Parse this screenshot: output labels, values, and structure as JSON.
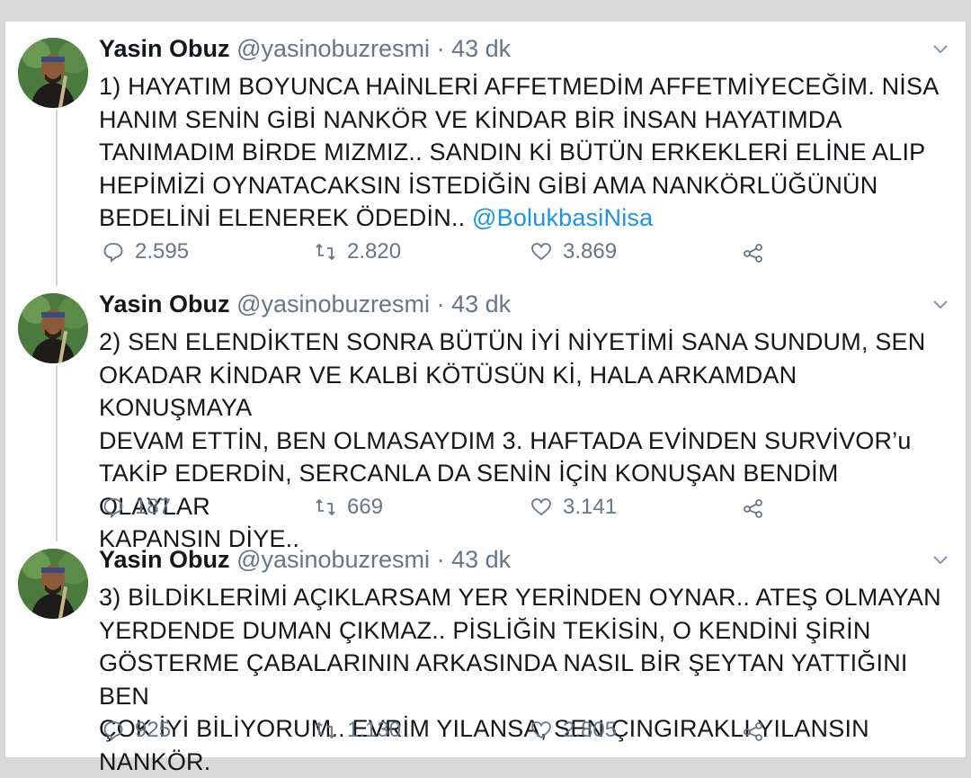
{
  "tweets": [
    {
      "name": "Yasin Obuz",
      "handle": "@yasinobuzresmi",
      "separator": "·",
      "time": "43 dk",
      "text_lines": [
        "1) HAYATIM BOYUNCA HAİNLERİ AFFETMEDİM AFFETMİYECEĞİM. NİSA",
        "HANIM SENİN GİBİ NANKÖR VE KİNDAR BİR İNSAN HAYATIMDA",
        "TANIMADIM BİRDE MIZMIZ.. SANDIN Kİ BÜTÜN ERKEKLERİ ELİNE ALIP",
        "HEPİMİZİ OYNATACAKSIN İSTEDİĞİN GİBİ AMA NANKÖRLÜĞÜNÜN",
        "BEDELİNİ ELENEREK ÖDEDİN.. "
      ],
      "mention": "@BolukbasiNisa",
      "replies": "2.595",
      "retweets": "2.820",
      "likes": "3.869"
    },
    {
      "name": "Yasin Obuz",
      "handle": "@yasinobuzresmi",
      "separator": "·",
      "time": "43 dk",
      "text_lines": [
        "2) SEN ELENDİKTEN SONRA BÜTÜN İYİ NİYETİMİ SANA SUNDUM, SEN",
        "OKADAR KİNDAR VE KALBİ KÖTÜSÜN Kİ, HALA ARKAMDAN KONUŞMAYA",
        "DEVAM ETTİN, BEN OLMASAYDIM 3. HAFTADA EVİNDEN SURVİVOR’u",
        "TAKİP EDERDİN, SERCANLA DA SENİN İÇİN KONUŞAN BENDİM OLAYLAR",
        "KAPANSIN DİYE.."
      ],
      "mention": "",
      "replies": "187",
      "retweets": "669",
      "likes": "3.141"
    },
    {
      "name": "Yasin Obuz",
      "handle": "@yasinobuzresmi",
      "separator": "·",
      "time": "43 dk",
      "text_lines": [
        "3) BİLDİKLERİMİ AÇIKLARSAM YER YERİNDEN OYNAR.. ATEŞ OLMAYAN",
        "YERDENDE DUMAN ÇIKMAZ.. PİSLİĞİN TEKİSİN, O KENDİNİ ŞİRİN",
        "GÖSTERME ÇABALARININ ARKASINDA NASIL BİR ŞEYTAN YATTIĞINI BEN",
        "ÇOK İYİ BİLİYORUM.. EVRİM YILANSA, SEN ÇINGIRAKLI YILANSIN NANKÖR."
      ],
      "mention": "",
      "replies": "925",
      "retweets": "1.130",
      "likes": "2.805"
    }
  ],
  "colors": {
    "text": "#14171a",
    "secondary": "#657786",
    "link": "#1b95e0",
    "thread_line": "#cfd4d8"
  },
  "icons": [
    "reply-icon",
    "retweet-icon",
    "like-icon",
    "share-icon",
    "chevron-down-icon"
  ]
}
